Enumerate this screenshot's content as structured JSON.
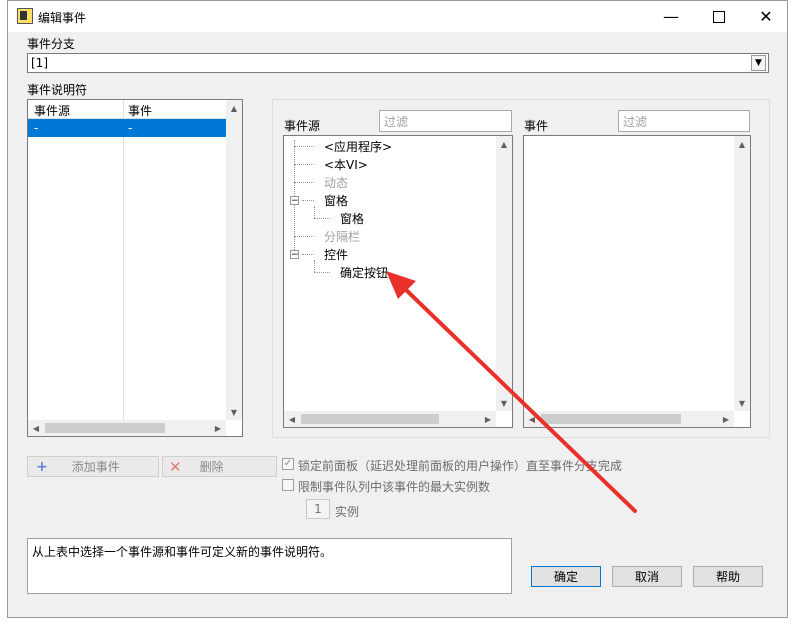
{
  "window": {
    "title": "编辑事件"
  },
  "branch": {
    "label": "事件分支",
    "value": "[1]"
  },
  "specifiers": {
    "label": "事件说明符",
    "columns": [
      "事件源",
      "事件"
    ],
    "rows": [
      [
        "-",
        "-"
      ]
    ]
  },
  "source_panel": {
    "label": "事件源",
    "filter_placeholder": "过滤",
    "tree": {
      "app": "<应用程序>",
      "this_vi": "<本VI>",
      "dynamic": "动态",
      "pane_group": "窗格",
      "pane_child": "窗格",
      "splitter": "分隔栏",
      "controls_group": "控件",
      "control_child": "确定按钮"
    }
  },
  "event_panel": {
    "label": "事件",
    "filter_placeholder": "过滤"
  },
  "buttons": {
    "add": "添加事件",
    "delete": "删除",
    "ok": "确定",
    "cancel": "取消",
    "help": "帮助"
  },
  "options": {
    "lock_panel": "锁定前面板（延迟处理前面板的用户操作）直至事件分支完成",
    "limit_queue": "限制事件队列中该事件的最大实例数",
    "instances_value": "1",
    "instances_label": "实例"
  },
  "description": "从上表中选择一个事件源和事件可定义新的事件说明符。",
  "colors": {
    "selection": "#0078d7",
    "annotation": "#e8312a"
  }
}
